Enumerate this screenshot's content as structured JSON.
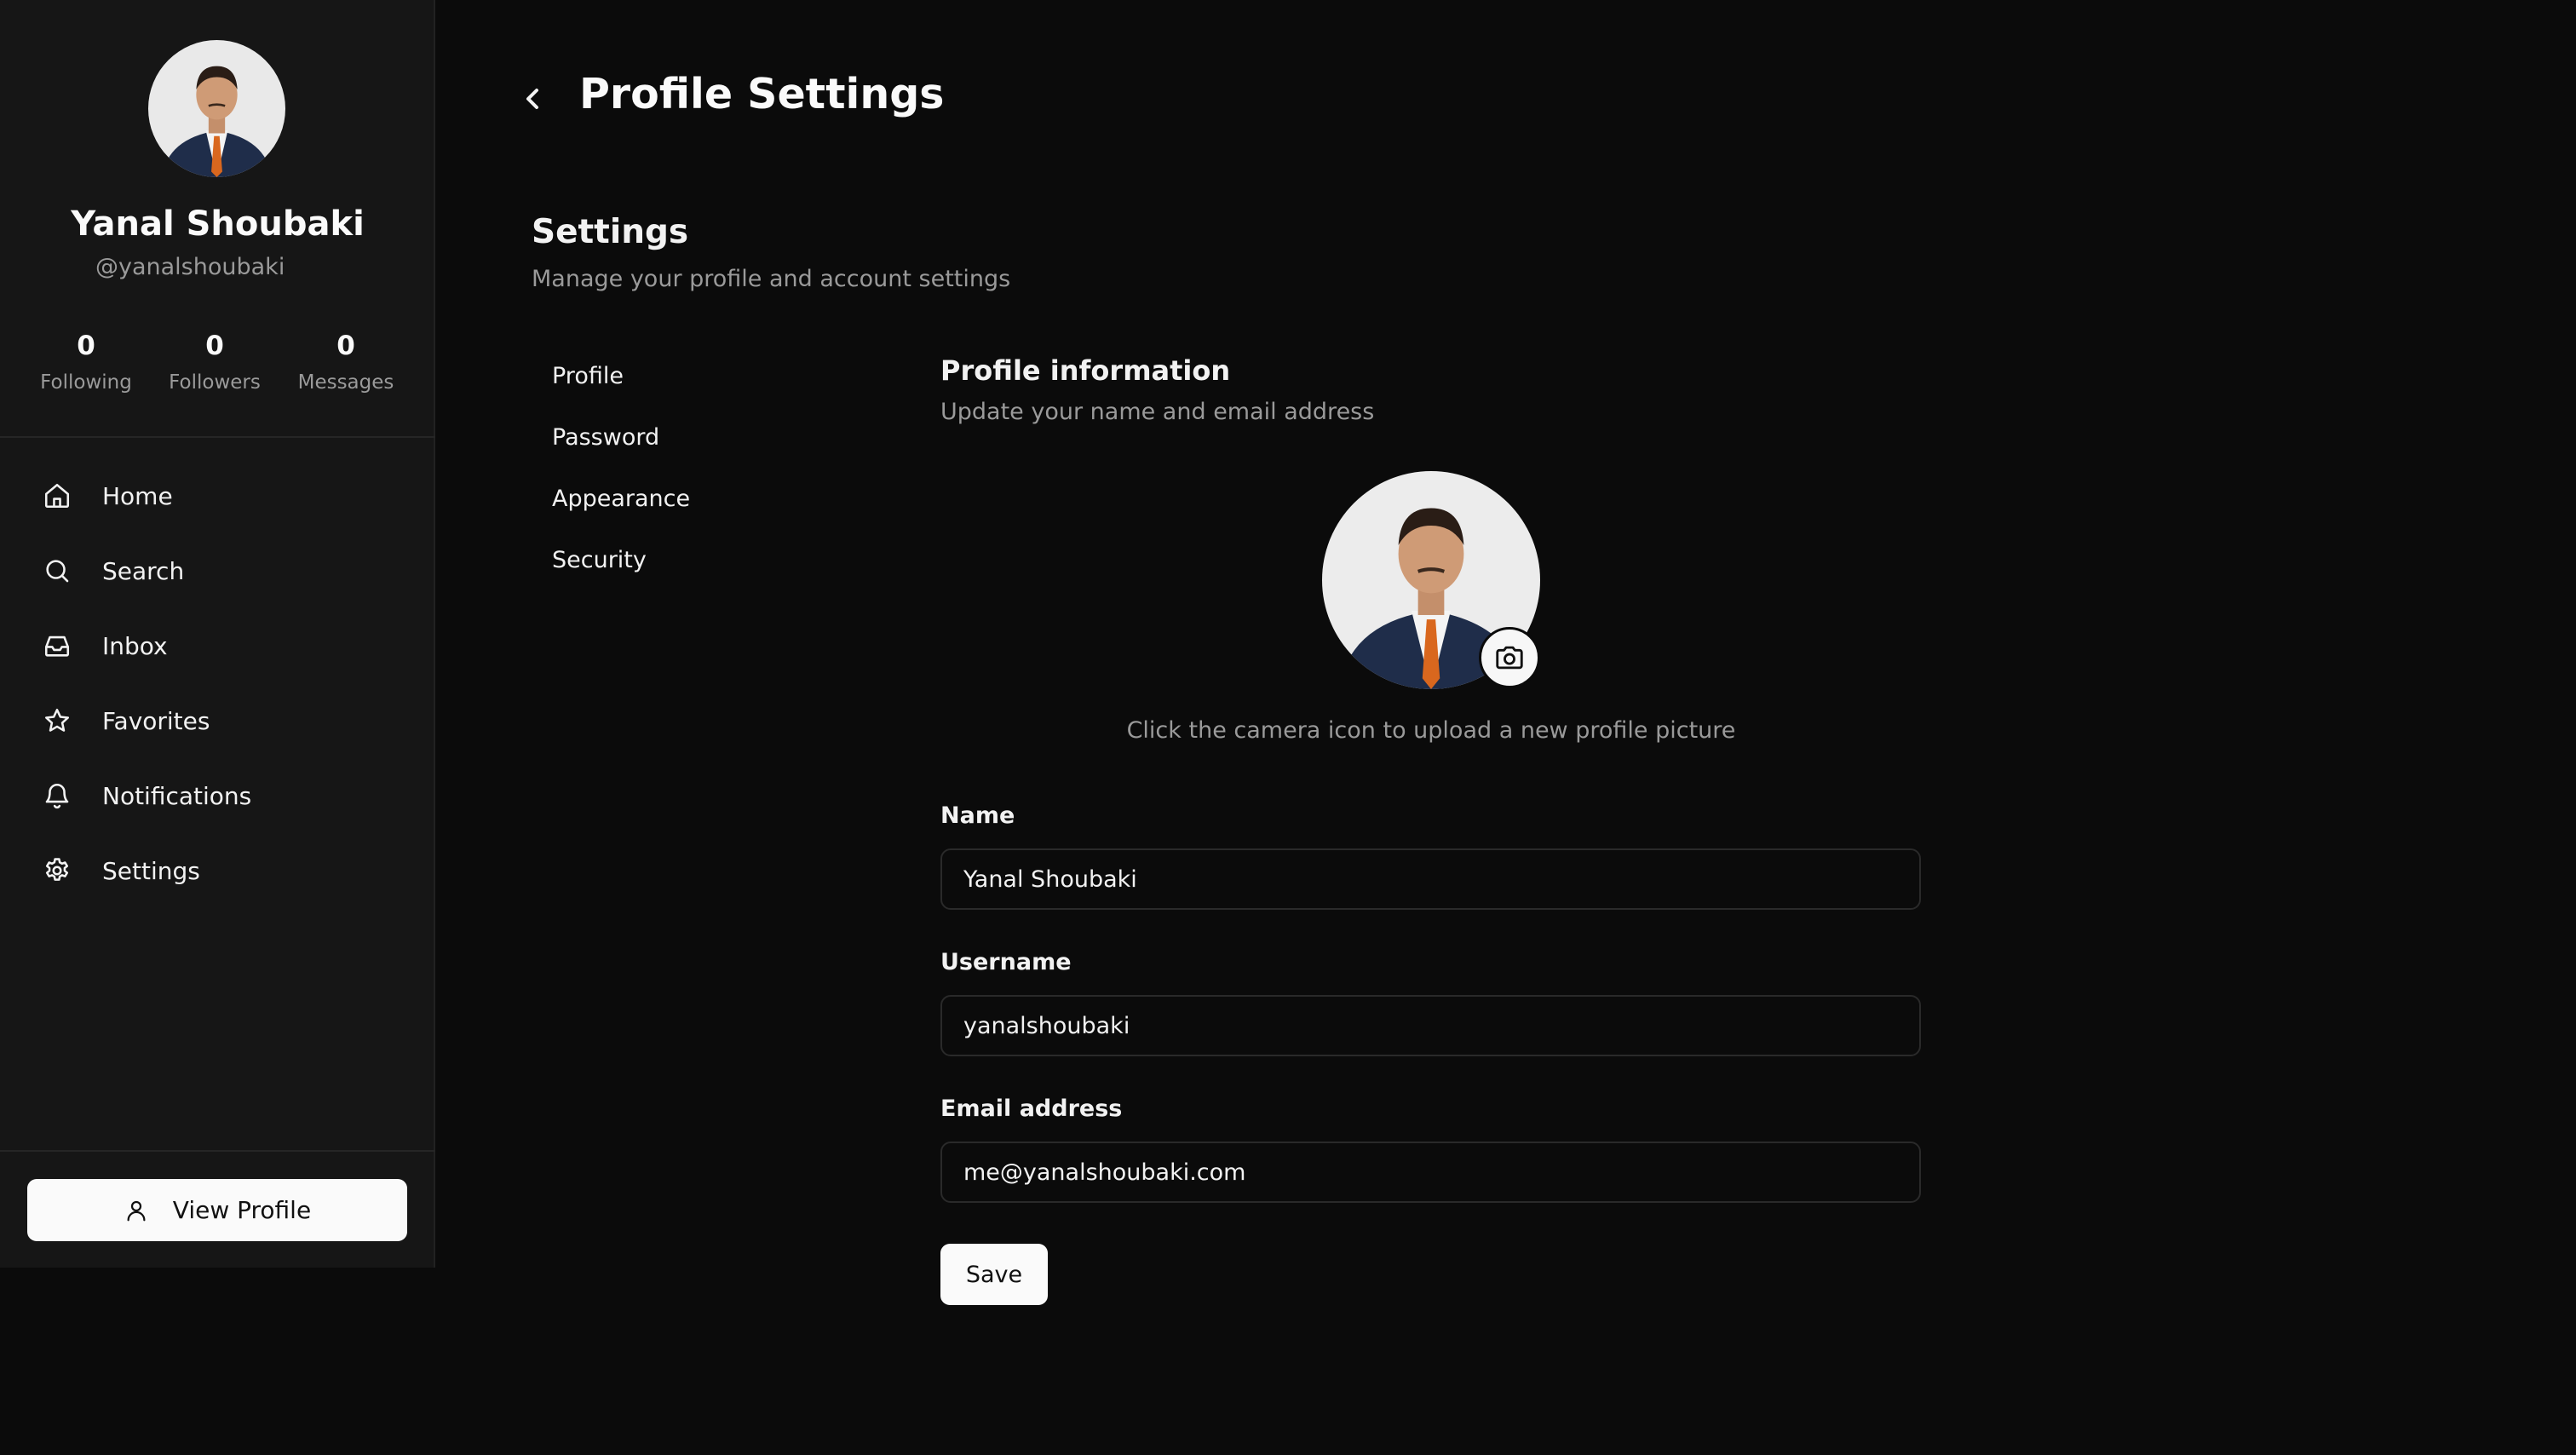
{
  "user": {
    "name": "Yanal Shoubaki",
    "handle": "@yanalshoubaki",
    "avatar_alt": "profile photo"
  },
  "stats": [
    {
      "value": "0",
      "label": "Following"
    },
    {
      "value": "0",
      "label": "Followers"
    },
    {
      "value": "0",
      "label": "Messages"
    }
  ],
  "nav": [
    {
      "label": "Home",
      "icon": "home-icon"
    },
    {
      "label": "Search",
      "icon": "search-icon"
    },
    {
      "label": "Inbox",
      "icon": "inbox-icon"
    },
    {
      "label": "Favorites",
      "icon": "star-icon"
    },
    {
      "label": "Notifications",
      "icon": "bell-icon"
    },
    {
      "label": "Settings",
      "icon": "gear-icon"
    }
  ],
  "view_profile_label": "View Profile",
  "page_title": "Profile Settings",
  "settings": {
    "title": "Settings",
    "subtitle": "Manage your profile and account settings",
    "tabs": [
      "Profile",
      "Password",
      "Appearance",
      "Security"
    ]
  },
  "profile_info": {
    "title": "Profile information",
    "subtitle": "Update your name and email address",
    "upload_hint": "Click the camera icon to upload a new profile picture"
  },
  "form": {
    "name_label": "Name",
    "name_value": "Yanal Shoubaki",
    "username_label": "Username",
    "username_value": "yanalshoubaki",
    "email_label": "Email address",
    "email_value": "me@yanalshoubaki.com",
    "save_label": "Save"
  },
  "colors": {
    "background": "#0b0b0b",
    "sidebar": "#161616",
    "text_muted": "#9a9a9a",
    "button_bg": "#fafafa"
  }
}
